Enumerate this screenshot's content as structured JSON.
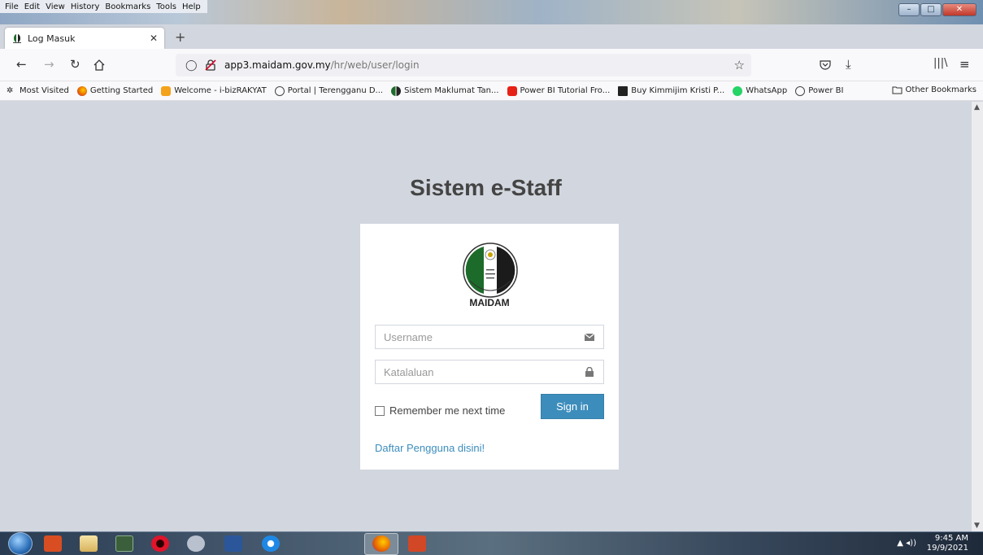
{
  "browser": {
    "menu_items": [
      "File",
      "Edit",
      "View",
      "History",
      "Bookmarks",
      "Tools",
      "Help"
    ],
    "tab_title": "Log Masuk",
    "url_host": "app3.maidam.gov.my",
    "url_path": "/hr/web/user/login",
    "bookmarks": [
      {
        "label": "Most Visited",
        "icon": "gear-icon",
        "color": "#555555"
      },
      {
        "label": "Getting Started",
        "icon": "firefox-icon",
        "color": "#e66000"
      },
      {
        "label": "Welcome - i-bizRAKYAT",
        "icon": "bizrakyat-icon",
        "color": "#f4a21b"
      },
      {
        "label": "Portal | Terengganu D...",
        "icon": "globe-icon",
        "color": "#444444"
      },
      {
        "label": "Sistem Maklumat Tan...",
        "icon": "maidam-icon",
        "color": "#1d6b2a"
      },
      {
        "label": "Power BI Tutorial Fro...",
        "icon": "youtube-icon",
        "color": "#e62117"
      },
      {
        "label": "Buy Kimmijim Kristi P...",
        "icon": "z-icon",
        "color": "#222222"
      },
      {
        "label": "WhatsApp",
        "icon": "whatsapp-icon",
        "color": "#25d366"
      },
      {
        "label": "Power BI",
        "icon": "globe-icon",
        "color": "#444444"
      }
    ],
    "other_bookmarks": "Other Bookmarks"
  },
  "login": {
    "heading": "Sistem e-Staff",
    "logo_label": "MAIDAM",
    "username_placeholder": "Username",
    "password_placeholder": "Katalaluan",
    "remember_label": "Remember me next time",
    "remember_checked": false,
    "signin_label": "Sign in",
    "register_link": "Daftar Pengguna disini!",
    "accent_color": "#3c8dbc"
  },
  "taskbar": {
    "time": "9:45 AM",
    "date": "19/9/2021"
  }
}
